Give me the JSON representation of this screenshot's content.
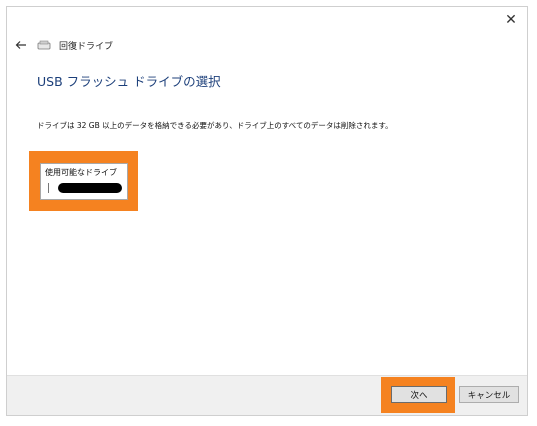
{
  "window": {
    "close_glyph": "✕",
    "nav": {
      "back_icon": "back-arrow-icon",
      "drive_icon": "drive-icon",
      "title": "回復ドライブ"
    },
    "page_title": "USB フラッシュ ドライブの選択",
    "description": "ドライブは 32 GB 以上のデータを格納できる必要があり、ドライブ上のすべてのデータは削除されます。",
    "drive_list": {
      "label": "使用可能なドライブ",
      "items": [
        {
          "label": "(redacted drive name)"
        }
      ]
    },
    "footer": {
      "next_label": "次へ",
      "cancel_label": "キャンセル"
    },
    "colors": {
      "title_blue": "#1c3f7a",
      "highlight_orange": "#f58220",
      "footer_bg": "#f0f0f0"
    }
  }
}
